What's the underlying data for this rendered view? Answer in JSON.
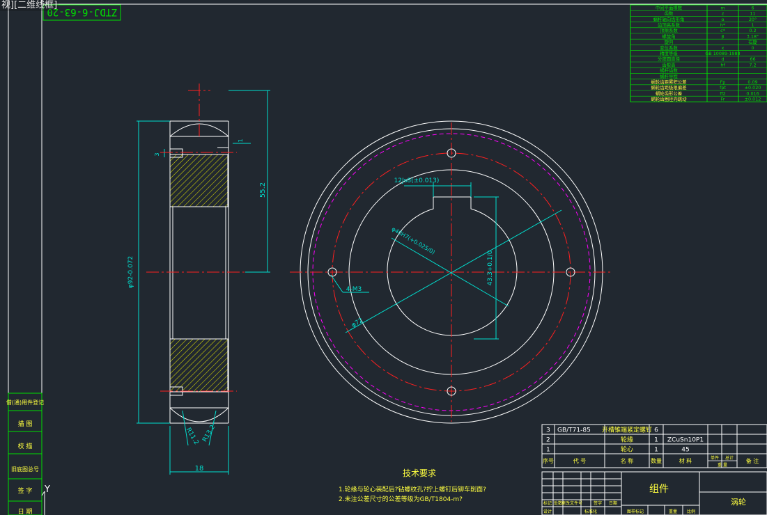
{
  "viewport_label": "视]",
  "visual_style": "[二维线框]",
  "drawing_number": "ZTDJ-6-63-20",
  "side_view": {
    "dims": {
      "outer_dia": "φ92-0.072",
      "height": "55.2",
      "width": "18",
      "r1": "R11.2",
      "r2": "R13.2",
      "d3": "3",
      "d1": "1"
    }
  },
  "front_view": {
    "dims": {
      "keyway": "12Js8(±0.013)",
      "bore": "φ40H7(+0.025/0)",
      "depth": "43.3+0.1/0",
      "holes": "4-M3",
      "pcd": "φ72"
    }
  },
  "param_table": {
    "rows": [
      [
        "中间平面模数",
        "m",
        "6"
      ],
      [
        "齿数",
        "z",
        "11"
      ],
      [
        "蜗杆轴向齿形角",
        "α",
        "20°"
      ],
      [
        "齿顶高系数",
        "h*",
        "1"
      ],
      [
        "顶隙系数",
        "c*",
        "0.2"
      ],
      [
        "螺旋角",
        "β",
        "3.18°"
      ],
      [
        "旋向",
        "",
        "右旋"
      ],
      [
        "变位系数",
        "x",
        "0"
      ],
      [
        "精度等级",
        "GB 10089-1988",
        ""
      ],
      [
        "分度圆直径",
        "d",
        "66"
      ],
      [
        "齿根高",
        "hf",
        "7.2"
      ],
      [
        "蜗杆齿数",
        "",
        ""
      ],
      [
        "蜗杆导程",
        "",
        ""
      ],
      [
        "蜗轮齿距累积公差",
        "Fp",
        "0.09"
      ],
      [
        "蜗轮齿距极限偏差",
        "fpt",
        "±0.020"
      ],
      [
        "蜗轮齿形公差",
        "ff2",
        "0.016"
      ],
      [
        "蜗轮齿圈径向跳动",
        "Fr",
        "±0.012"
      ]
    ]
  },
  "bom": {
    "rows": [
      [
        "3",
        "GB/T71-85",
        "开槽锥端紧定螺钉",
        "6",
        ""
      ],
      [
        "2",
        "",
        "轮缘",
        "1",
        "ZCuSn10P1"
      ],
      [
        "1",
        "",
        "轮心",
        "1",
        "45"
      ]
    ],
    "headers": [
      "序号",
      "代 号",
      "名 称",
      "数量",
      "材 料",
      "单件",
      "总计",
      "备 注"
    ],
    "weight_label": "重 量"
  },
  "title_block": {
    "part_name": "组件",
    "title": "涡轮",
    "cells": [
      "标记",
      "处数",
      "更改文件号",
      "签字",
      "日期",
      "设计",
      "标准化",
      "图样标记",
      "重量",
      "比例"
    ]
  },
  "notes": {
    "heading": "技术要求",
    "lines": [
      "1.轮缘与轮心装配后?钻螺纹孔?拧上螺钉后铆车削面?",
      "2.未注公差尺寸的公差等级为GB/T1804-m?"
    ]
  },
  "left_strip": [
    "借(通)用件登记",
    "描 图",
    "校 描",
    "旧底图总号",
    "签 字",
    "日 期"
  ],
  "ucs_label": "Y",
  "colors": {
    "background": "#212830",
    "line": "#ffffff",
    "dimension": "#00e0d0",
    "centerline": "#ff2020",
    "pitch_circle": "#ff00ff",
    "hatch": "#e6e600",
    "text": "#ffff40",
    "table": "#00e000"
  }
}
